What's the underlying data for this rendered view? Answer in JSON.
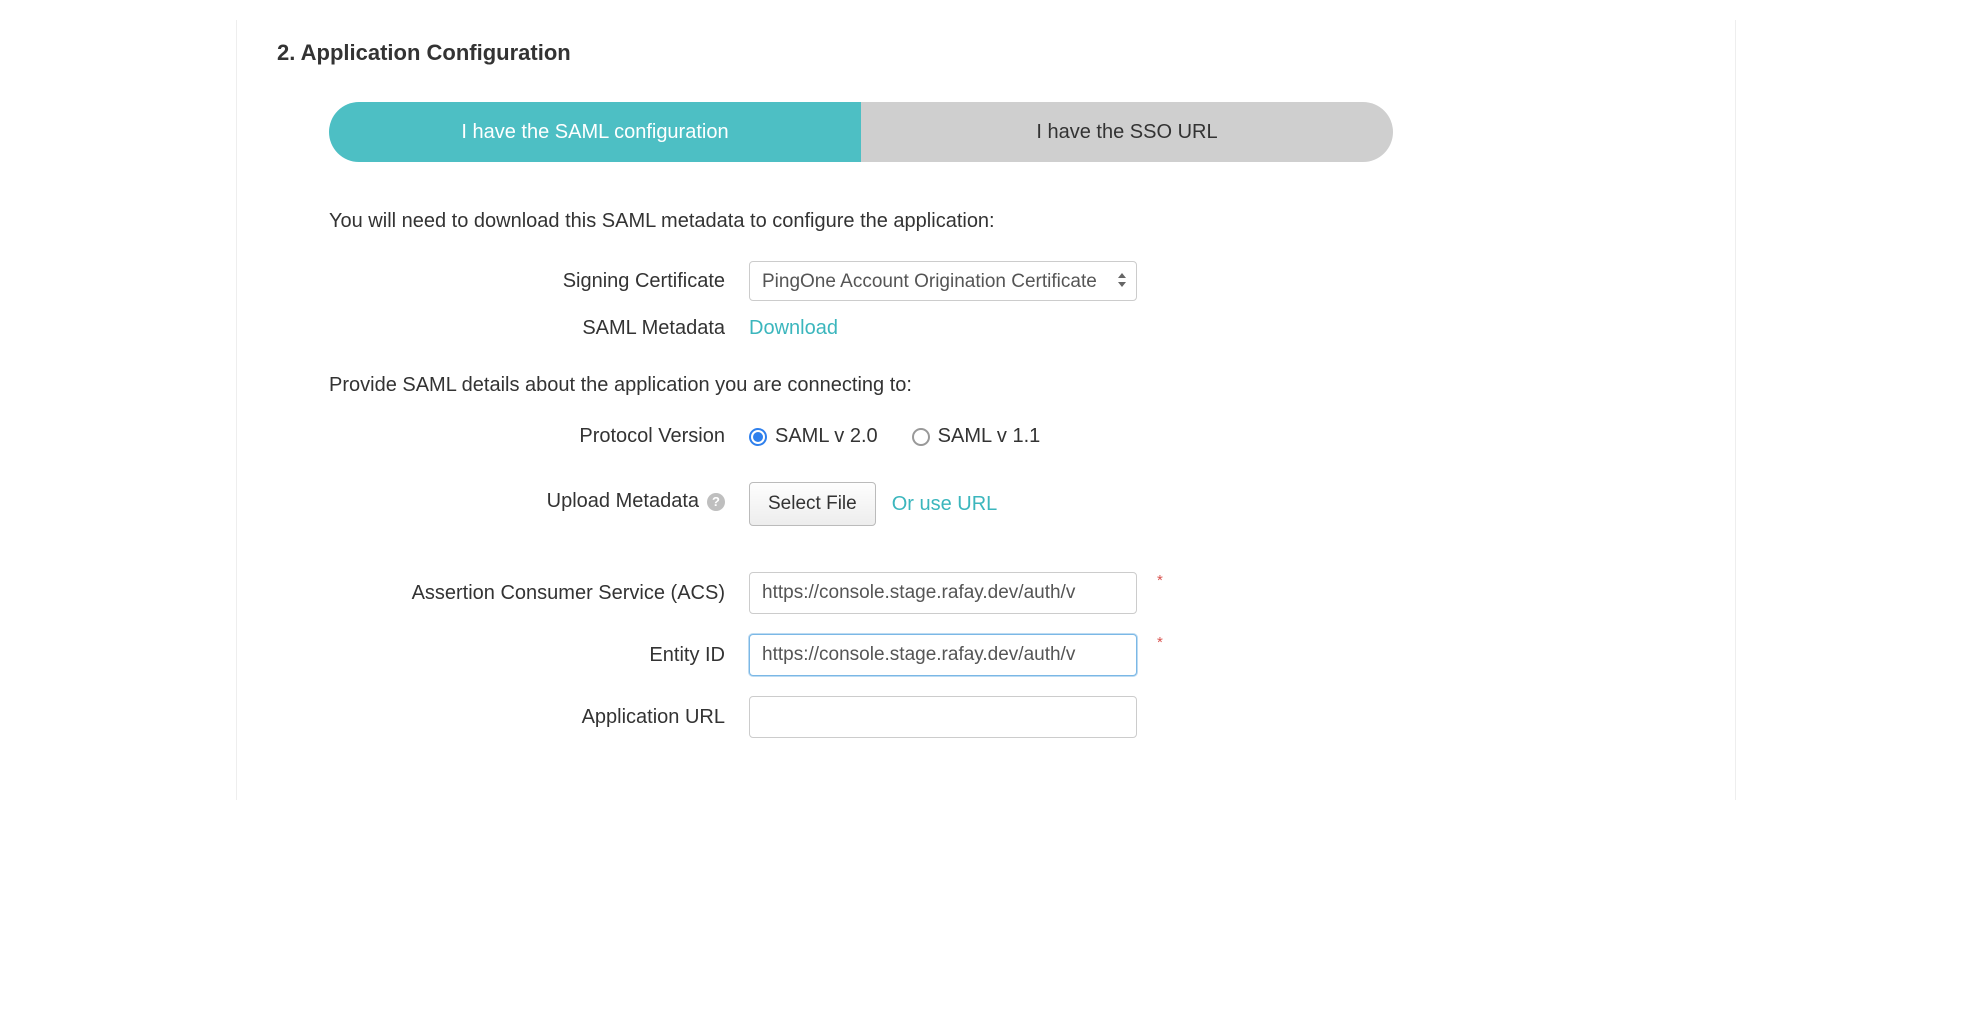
{
  "heading": "2. Application Configuration",
  "tabs": {
    "saml_config": "I have the SAML configuration",
    "sso_url": "I have the SSO URL"
  },
  "instructions": {
    "download_metadata": "You will need to download this SAML metadata to configure the application:",
    "provide_details": "Provide SAML details about the application you are connecting to:"
  },
  "labels": {
    "signing_certificate": "Signing Certificate",
    "saml_metadata": "SAML Metadata",
    "protocol_version": "Protocol Version",
    "upload_metadata": "Upload Metadata",
    "acs": "Assertion Consumer Service (ACS)",
    "entity_id": "Entity ID",
    "application_url": "Application URL"
  },
  "fields": {
    "signing_certificate_selected": "PingOne Account Origination Certificate",
    "download_link": "Download",
    "protocol_options": {
      "saml_v2": "SAML v 2.0",
      "saml_v11": "SAML v 1.1"
    },
    "select_file_button": "Select File",
    "or_use_url_link": "Or use URL",
    "acs_value": "https://console.stage.rafay.dev/auth/v",
    "entity_id_value": "https://console.stage.rafay.dev/auth/v",
    "application_url_value": ""
  },
  "markers": {
    "required": "*",
    "help": "?"
  }
}
